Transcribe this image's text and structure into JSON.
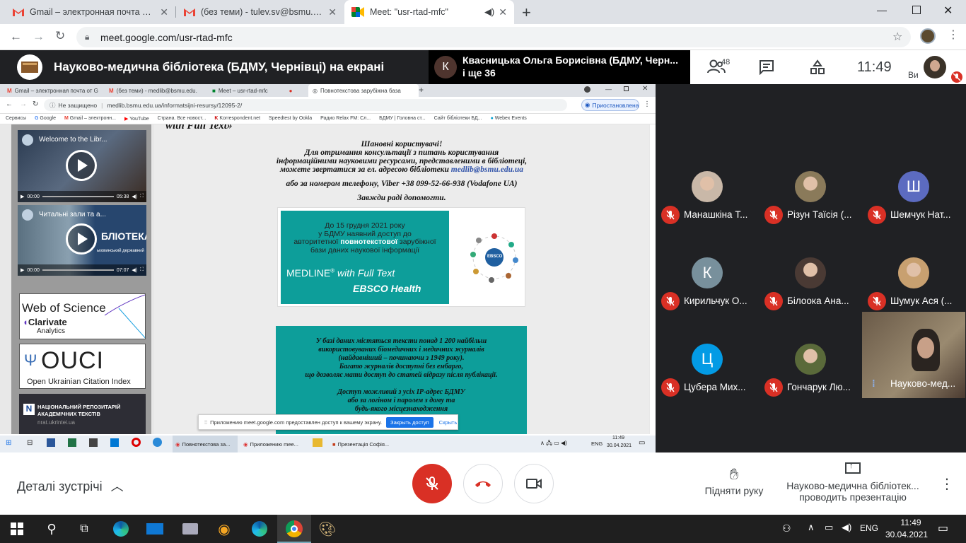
{
  "browser": {
    "tabs": [
      {
        "title": "Gmail – электронная почта от G",
        "icon": "gmail-icon"
      },
      {
        "title": "(без теми) - tulev.sv@bsmu.edu.",
        "icon": "gmail-icon"
      },
      {
        "title": "Meet: \"usr-rtad-mfc\"",
        "icon": "meet-icon",
        "active": true
      }
    ],
    "new_tab": "+",
    "url": "meet.google.com/usr-rtad-mfc"
  },
  "meet": {
    "presenter_banner": "Науково-медична бібліотека (БДМУ, Чернівці) на екрані",
    "speaker_initial": "К",
    "speaker_name": "Квасницька Ольга Борисівна (БДМУ, Черн...",
    "speaker_more": "і ще 36",
    "participants_count": "48",
    "time": "11:49",
    "self_label": "Ви",
    "tiles": [
      {
        "name": "Манашкіна Т...",
        "avatar": "photo",
        "color": "#c9b8a8"
      },
      {
        "name": "Різун Таїсія (...",
        "avatar": "photo",
        "color": "#8a7a5a"
      },
      {
        "name": "Шемчук Нат...",
        "avatar": "Ш",
        "color": "#5c6bc0"
      },
      {
        "name": "Кирильчук О...",
        "avatar": "К",
        "color": "#78909c"
      },
      {
        "name": "Білоока Ана...",
        "avatar": "photo",
        "color": "#4a3a34"
      },
      {
        "name": "Шумук Ася (...",
        "avatar": "photo",
        "color": "#c8a070"
      },
      {
        "name": "Цубера Мих...",
        "avatar": "Ц",
        "color": "#039be5"
      },
      {
        "name": "Гончарук Лю...",
        "avatar": "photo",
        "color": "#5a6a3a"
      },
      {
        "name": "Науково-мед...",
        "avatar": "video",
        "color": "#7a6a5a"
      }
    ],
    "bottom": {
      "details": "Деталі зустрічі",
      "raise_hand": "Підняти руку",
      "presenting_line1": "Науково-медична бібліотек...",
      "presenting_line2": "проводить презентацію"
    }
  },
  "shared_screen": {
    "tabs": [
      "Gmail – электронная почта от G",
      "(без теми) - medlib@bsmu.edu.",
      "Meet – usr-rtad-mfc",
      "Повнотекстова зарубіжна база"
    ],
    "not_secure": "Не защищено",
    "url": "medlib.bsmu.edu.ua/informatsijni-resursy/12095-2/",
    "paused": "Приостановлена",
    "bookmarks": [
      "Сервисы",
      "Google",
      "Gmail – электронн...",
      "YouTube",
      "Страна. Все новост...",
      "Korrespondent.net",
      "Speedtest by Ookla",
      "Радио Relax FM: Сл...",
      "БДМУ | Головна ст...",
      "Сайт бібліотеки БД...",
      "Webex Events"
    ],
    "videos": [
      {
        "title": "Welcome to the Libr...",
        "time_cur": "00:00",
        "time_total": "05:38"
      },
      {
        "title": "Читальні зали та а...",
        "time_cur": "00:00",
        "time_total": "07:07",
        "overlay": "БЛІОТЕКА",
        "overlay_sub": "ьковинський державний"
      }
    ],
    "logos": {
      "wos_line1": "Web of Science",
      "wos_line2": "Clarivate",
      "wos_line3": "Analytics",
      "ouci": "OUCI",
      "ouci_sub": "Open Ukrainian Citation Index",
      "nrat_line1": "НАЦІОНАЛЬНИЙ РЕПОЗИТАРІЙ",
      "nrat_line2": "АКАДЕМІЧНИХ ТЕКСТІВ",
      "nrat_line3": "nrat.ukrintei.ua"
    },
    "page_cut_heading": "with Full Text»",
    "greeting": "Шановні користувачі!",
    "para1": "Для отримання консультації з питань користування",
    "para2": "інформаційними науковими ресурсами, представленими в бібліотеці,",
    "para3_prefix": "можете звертатися за ел. адресою бібліотеки ",
    "email": "medlib@bsmu.edu.ua",
    "phone": "або за номером телефону, Viber +38 099-52-66-938 (Vodafone UA)",
    "help": "Завжди раді допомогти.",
    "banner1": "До 15 грудня 2021 року",
    "banner2": "у БДМУ наявний доступ до",
    "banner3_a": "авторитетної ",
    "banner3_b": "повнотекстової",
    "banner3_c": " зарубіжної",
    "banner4": "бази даних наукової інформації",
    "banner_medline": "MEDLINE",
    "banner_reg": "®",
    "banner_fulltext": " with Full Text",
    "banner_ebsco": "EBSCO Health",
    "ebsco_logo": "EBSCO",
    "box1": "У базі даних містяться тексти понад 1 200 найбільш",
    "box2": "використовуваних біомедичних і медичних журналів",
    "box3": "(найдавніший – починаючи з 1949 року).",
    "box4": "Багато журналів доступні без ембарго,",
    "box5": "що дозволяє мати доступ до статей відразу після публікації.",
    "box6": "Доступ можливий з усіх IP-адрес БДМУ",
    "box7": "або за логіном і паролем з дому та",
    "box8": "будь-якого місцезнаходження",
    "share_notice": "Приложению meet.google.com предоставлен доступ к вашему экрану.",
    "share_stop": "Закрыть доступ",
    "share_hide": "Скрыть",
    "taskbar_items": [
      "Повнотекстова за...",
      "Приложению mee...",
      "",
      "Презентація Софія..."
    ],
    "taskbar_lang": "ENG",
    "taskbar_time": "11:49",
    "taskbar_date": "30.04.2021"
  },
  "windows": {
    "lang": "ENG",
    "time": "11:49",
    "date": "30.04.2021"
  }
}
